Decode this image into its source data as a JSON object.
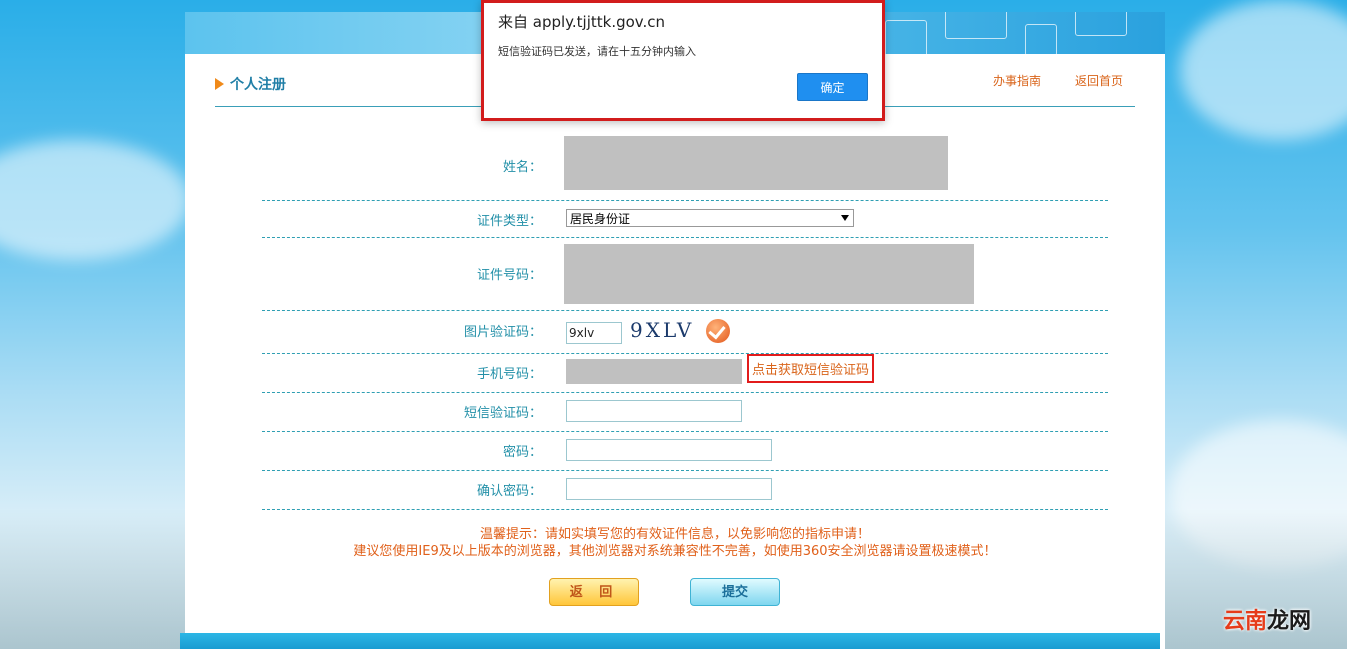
{
  "dialog": {
    "title": "来自 apply.tjjttk.gov.cn",
    "message": "短信验证码已发送，请在十五分钟内输入",
    "ok_label": "确定"
  },
  "header": {
    "title": "个人注册",
    "links": [
      "办事指南",
      "返回首页"
    ]
  },
  "form": {
    "name_label": "姓名：",
    "id_type_label": "证件类型：",
    "id_type_value": "居民身份证",
    "id_number_label": "证件号码：",
    "captcha_label": "图片验证码：",
    "captcha_input_value": "9xlv",
    "captcha_image_text": "9XLV",
    "phone_label": "手机号码：",
    "sms_link": "点击获取短信验证码",
    "sms_code_label": "短信验证码：",
    "password_label": "密码：",
    "confirm_password_label": "确认密码："
  },
  "tips": {
    "line1": "温馨提示：请如实填写您的有效证件信息，以免影响您的指标申请！",
    "line2": "建议您使用IE9及以上版本的浏览器，其他浏览器对系统兼容性不完善，如使用360安全浏览器请设置极速模式！"
  },
  "buttons": {
    "back_label": "返 回",
    "submit_label": "提交"
  },
  "watermark": {
    "brand_red": "云南",
    "brand_dark": "龙网"
  },
  "colors": {
    "accent": "#2390a8",
    "link": "#d9641a",
    "highlight_border": "#e21b1b",
    "dialog_button": "#1f8ff0"
  }
}
